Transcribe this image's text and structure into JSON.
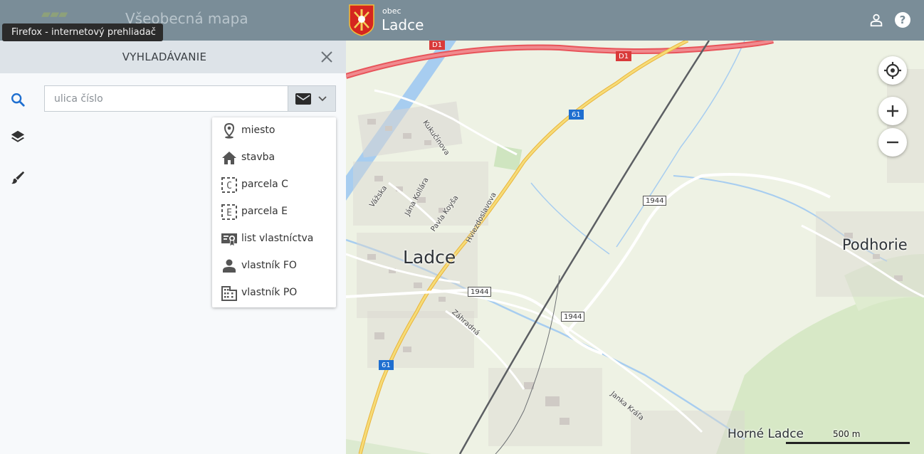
{
  "header": {
    "logo_text": "mapa",
    "app_title": "Všeobecná mapa",
    "municipality_type": "obec",
    "municipality_name": "Ladce",
    "user_icon": "user-icon",
    "help_icon": "help-icon",
    "background_color": "#7a8d98"
  },
  "tooltip": {
    "text": "Firefox - internetový prehliadač"
  },
  "rail": {
    "items": [
      {
        "icon": "search-icon",
        "active": true
      },
      {
        "icon": "layers-icon",
        "active": false
      },
      {
        "icon": "brush-icon",
        "active": false
      }
    ],
    "accent_color": "#1e6fd0"
  },
  "panel": {
    "title": "VYHLADÁVANIE",
    "close_icon": "close-icon",
    "search": {
      "placeholder": "ulica číslo",
      "value": "",
      "type_icon": "mail-icon"
    },
    "dropdown": [
      {
        "icon": "location-pin-icon",
        "label": "miesto"
      },
      {
        "icon": "home-icon",
        "label": "stavba"
      },
      {
        "icon": "parcel-c-icon",
        "label": "parcela C"
      },
      {
        "icon": "parcel-e-icon",
        "label": "parcela E"
      },
      {
        "icon": "certificate-icon",
        "label": "list vlastníctva"
      },
      {
        "icon": "person-icon",
        "label": "vlastník FO"
      },
      {
        "icon": "building-icon",
        "label": "vlastník PO"
      }
    ]
  },
  "map": {
    "places": [
      {
        "name": "Ladce"
      },
      {
        "name": "Podhorie"
      },
      {
        "name": "Horné Ladce"
      }
    ],
    "road_labels": [
      "D1",
      "D1",
      "61",
      "61",
      "1944",
      "1944",
      "1944"
    ],
    "streets": [
      "Kukučínova",
      "Vážska",
      "Jána Kollára",
      "Pavla Koyša",
      "Hviezdoslavova",
      "Záhradná",
      "Janka Kráľa"
    ],
    "controls": {
      "locate_icon": "locate-icon",
      "zoom_in_icon": "zoom-in-icon",
      "zoom_out_icon": "zoom-out-icon"
    },
    "scale_label": "500 m",
    "colors": {
      "motorway": "#e8545a",
      "primary_road": "#f2cf5b",
      "water": "#a7cdf0",
      "railway": "#5c5f63"
    }
  }
}
